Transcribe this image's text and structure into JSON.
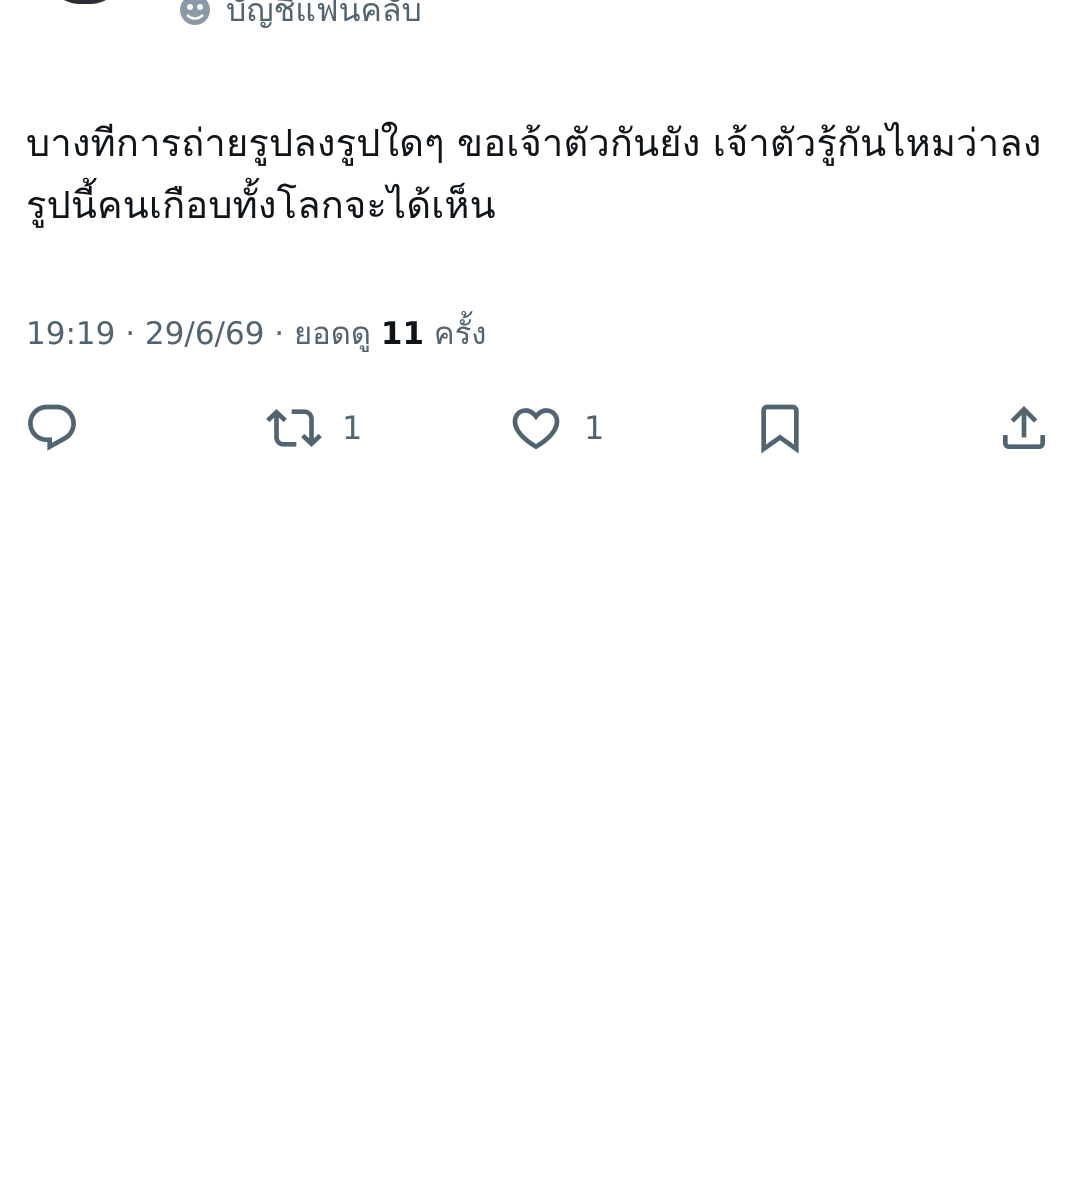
{
  "header": {
    "account_type_label": "บัญชีแฟนคลับ",
    "account_icon": "fan-club-icon"
  },
  "tweet": {
    "text": "บางทีการถ่ายรูปลงรูปใดๆ ขอเจ้าตัวกันยัง เจ้าตัวรู้กันไหมว่าลงรูปนี้คนเกือบทั้งโลกจะได้เห็น"
  },
  "meta": {
    "time": "19:19",
    "separator": "·",
    "date": "29/6/69",
    "views_prefix": "ยอดดู",
    "views_count": "11",
    "views_suffix": "ครั้ง"
  },
  "actions": {
    "reply": {
      "icon": "reply-icon",
      "count": ""
    },
    "retweet": {
      "icon": "retweet-icon",
      "count": "1"
    },
    "like": {
      "icon": "heart-icon",
      "count": "1"
    },
    "bookmark": {
      "icon": "bookmark-icon",
      "count": ""
    },
    "share": {
      "icon": "share-icon",
      "count": ""
    }
  },
  "colors": {
    "text_primary": "#0f1419",
    "text_secondary": "#536471",
    "background": "#ffffff"
  }
}
